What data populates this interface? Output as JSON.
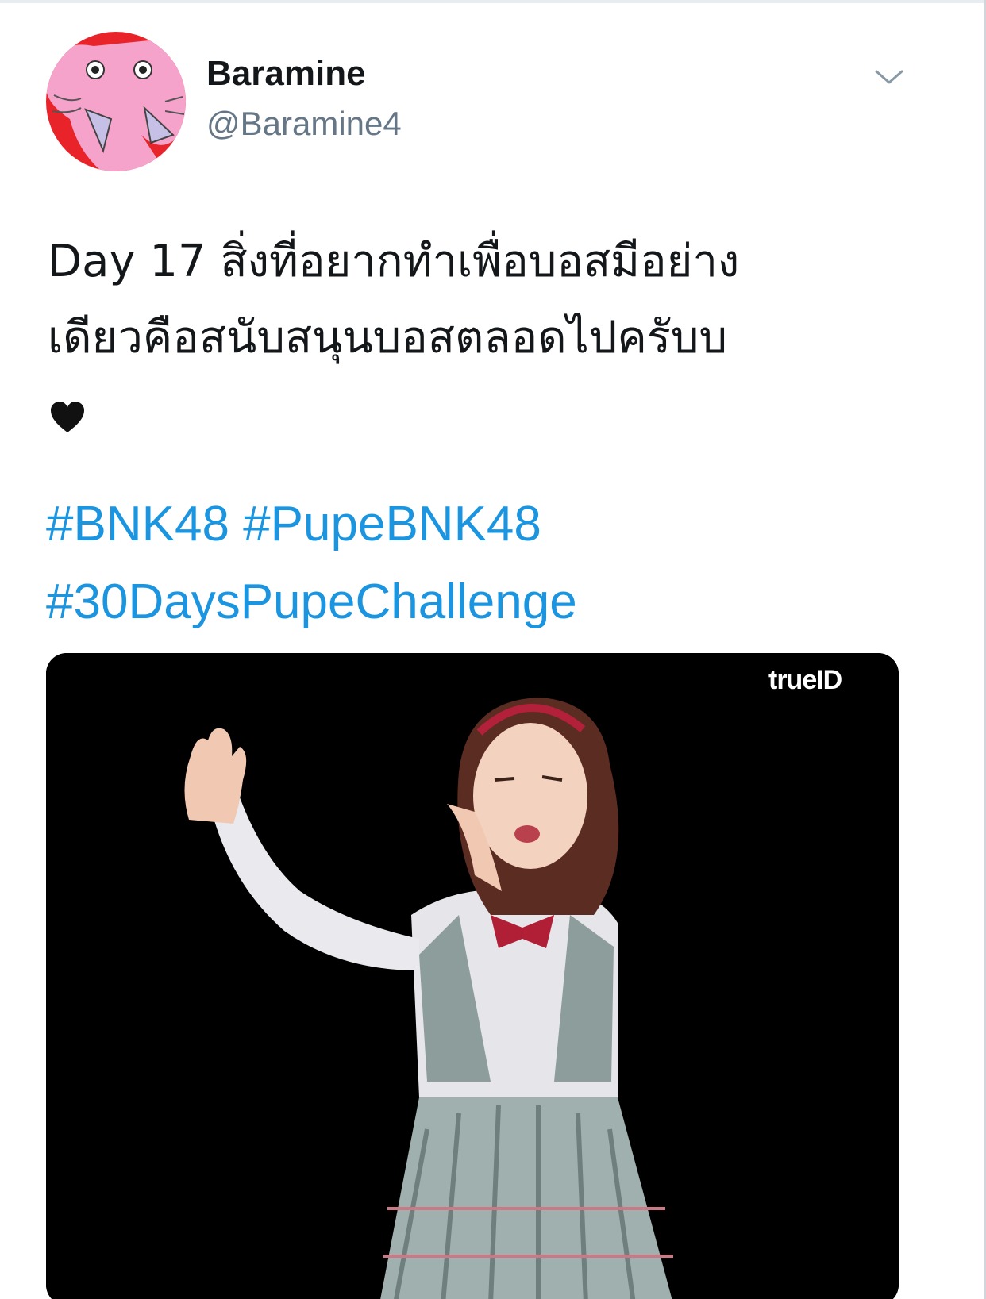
{
  "author": {
    "display_name": "Baramine",
    "handle": "@Baramine4"
  },
  "tweet": {
    "text_lines": [
      "Day 17 สิ่งที่อยากทำเพื่อบอสมีอย่าง",
      "เดียวคือสนับสนุนบอสตลอดไปครับบ"
    ],
    "hashtags": [
      "#BNK48",
      "#PupeBNK48",
      "#30DaysPupeChallenge"
    ]
  },
  "media": {
    "watermark": "trueID"
  },
  "icons": {
    "menu": "chevron-down-icon",
    "emoji": "black-heart-icon"
  },
  "colors": {
    "link": "#1b95e0",
    "text": "#14171a",
    "secondary": "#657786",
    "avatar_bg": "#e8242a",
    "avatar_face": "#f5a3cb"
  }
}
